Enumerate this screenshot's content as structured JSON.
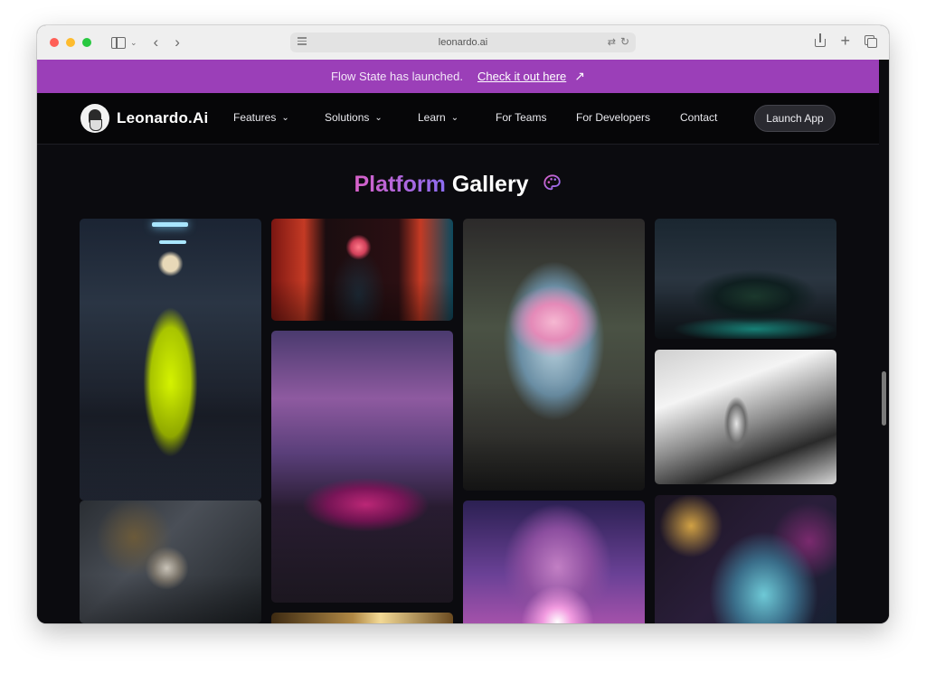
{
  "browser": {
    "url": "leonardo.ai"
  },
  "banner": {
    "text": "Flow State has launched.",
    "link_label": "Check it out here",
    "link_icon": "arrow-up-right-icon"
  },
  "nav": {
    "brand": "Leonardo.Ai",
    "items": [
      {
        "label": "Features",
        "dropdown": true
      },
      {
        "label": "Solutions",
        "dropdown": true
      },
      {
        "label": "Learn",
        "dropdown": true
      },
      {
        "label": "For Teams",
        "dropdown": false
      },
      {
        "label": "For Developers",
        "dropdown": false
      },
      {
        "label": "Contact",
        "dropdown": false
      }
    ],
    "cta": "Launch App"
  },
  "gallery": {
    "title_part1": "Platform",
    "title_part2": "Gallery",
    "title_icon": "palette-icon",
    "images": [
      "anime-girl-yellow-raincoat",
      "mechanical-skull-sculpture",
      "woman-red-neon-corridor",
      "purple-muscle-car-neon-city",
      "golden-abstract-partial",
      "crystal-lotus-sculpture",
      "pink-crystal-cosmos",
      "neon-motorcycle-night",
      "monochrome-warrior-cliffs",
      "marbled-face-sculpture"
    ]
  },
  "colors": {
    "banner_bg": "#9b3fb8",
    "page_bg": "#0b0b0f",
    "title_gradient_start": "#d861c8",
    "title_gradient_end": "#8b6cf0"
  }
}
